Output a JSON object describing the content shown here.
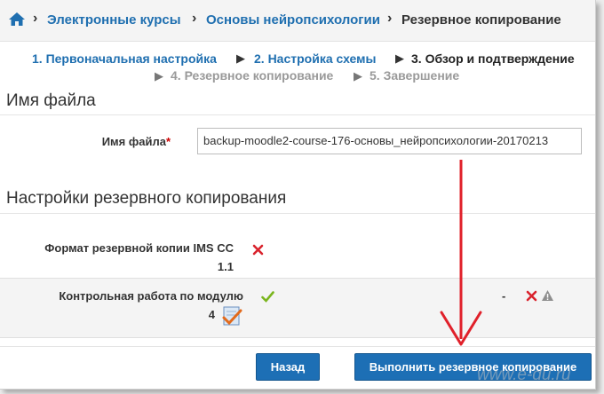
{
  "breadcrumb": {
    "items": [
      "Электронные курсы",
      "Основы нейропсихологии",
      "Резервное копирование"
    ],
    "separator": "›"
  },
  "steps": {
    "s1": "1. Первоначальная настройка",
    "s2": "2. Настройка схемы",
    "s3": "3. Обзор и подтверждение",
    "s4": "4. Резервное копирование",
    "s5": "5. Завершение",
    "arrow": "▶"
  },
  "file_section": {
    "heading": "Имя файла",
    "field_label": "Имя файла",
    "required_mark": "*",
    "value": "backup-moodle2-course-176-основы_нейропсихологии-20170213"
  },
  "backup_settings": {
    "heading": "Настройки резервного копирования",
    "ims_label_line1": "Формат резервной копии IMS CC",
    "ims_label_line2": "1.1",
    "module_label_line1": "Контрольная работа по модулю",
    "module_label_line2": "4",
    "module_dash": "-"
  },
  "buttons": {
    "back": "Назад",
    "run": "Выполнить резервное копирование"
  },
  "watermark": "www.e-du.ru",
  "colors": {
    "link": "#1f6fb0",
    "button": "#1d6fb5",
    "cross": "#d9232d",
    "check": "#7ab51d",
    "annotation_arrow": "#e0202a"
  }
}
